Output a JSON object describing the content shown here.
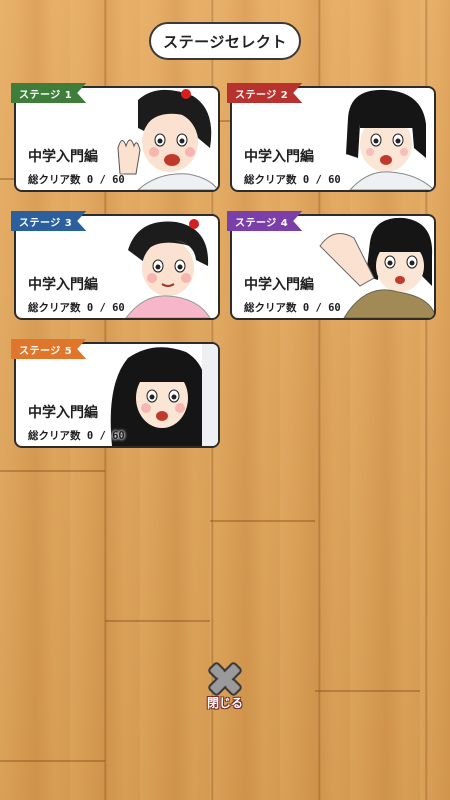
{
  "header": {
    "title": "ステージセレクト"
  },
  "stages": [
    {
      "ribbon": "ステージ 1",
      "ribbon_color": "#3f7d3a",
      "title": "中学入門編",
      "count": "総クリア数 0 / 60"
    },
    {
      "ribbon": "ステージ 2",
      "ribbon_color": "#b8322e",
      "title": "中学入門編",
      "count": "総クリア数 0 / 60"
    },
    {
      "ribbon": "ステージ 3",
      "ribbon_color": "#2b5f9e",
      "title": "中学入門編",
      "count": "総クリア数 0 / 60"
    },
    {
      "ribbon": "ステージ 4",
      "ribbon_color": "#7a3fa8",
      "title": "中学入門編",
      "count": "総クリア数 0 / 60"
    },
    {
      "ribbon": "ステージ 5",
      "ribbon_color": "#e0762c",
      "title": "中学入門編",
      "count": "総クリア数 0 / 60"
    }
  ],
  "footer": {
    "close_label": "閉じる"
  }
}
